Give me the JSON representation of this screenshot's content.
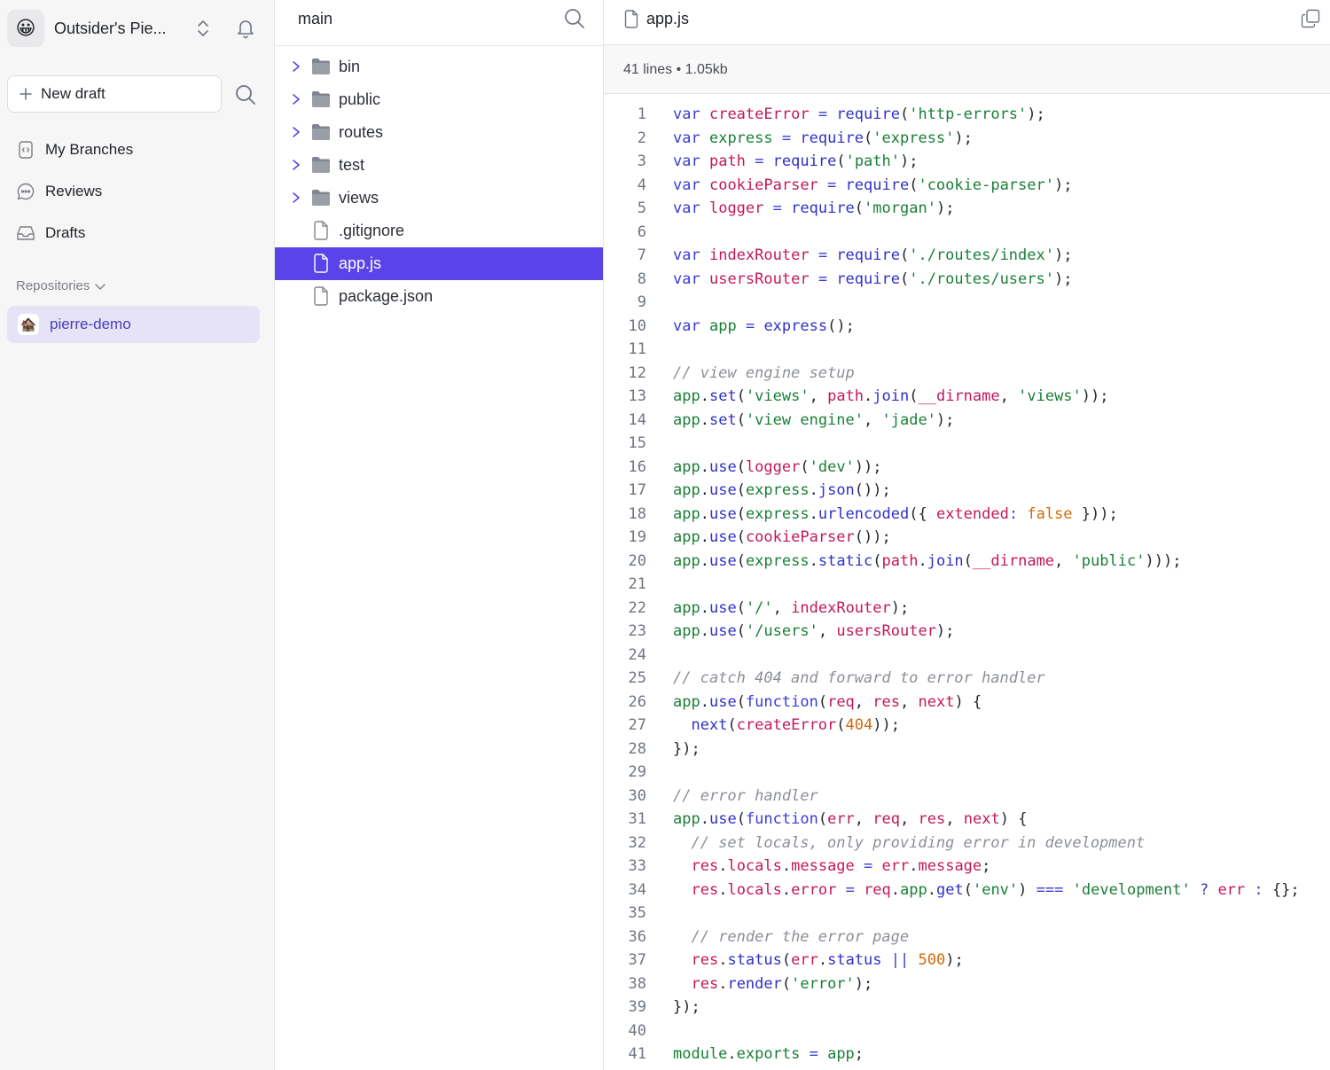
{
  "workspace": {
    "avatar_emoji": "😀",
    "name": "Outsider's Pie..."
  },
  "sidebar": {
    "new_draft_label": "New draft",
    "nav": [
      {
        "label": "My Branches",
        "icon": "branch-file-icon"
      },
      {
        "label": "Reviews",
        "icon": "chat-bubble-icon"
      },
      {
        "label": "Drafts",
        "icon": "inbox-tray-icon"
      }
    ],
    "repositories_heading": "Repositories",
    "repositories": [
      {
        "name": "pierre-demo",
        "icon_emoji": "🏚️",
        "selected": true
      }
    ]
  },
  "tree": {
    "branch": "main",
    "items": [
      {
        "label": "bin",
        "type": "folder"
      },
      {
        "label": "public",
        "type": "folder"
      },
      {
        "label": "routes",
        "type": "folder"
      },
      {
        "label": "test",
        "type": "folder"
      },
      {
        "label": "views",
        "type": "folder"
      },
      {
        "label": ".gitignore",
        "type": "file"
      },
      {
        "label": "app.js",
        "type": "file",
        "selected": true
      },
      {
        "label": "package.json",
        "type": "file"
      }
    ]
  },
  "file": {
    "name": "app.js",
    "meta": "41 lines • 1.05kb",
    "lines": [
      "var createError = require('http-errors');",
      "var express = require('express');",
      "var path = require('path');",
      "var cookieParser = require('cookie-parser');",
      "var logger = require('morgan');",
      "",
      "var indexRouter = require('./routes/index');",
      "var usersRouter = require('./routes/users');",
      "",
      "var app = express();",
      "",
      "// view engine setup",
      "app.set('views', path.join(__dirname, 'views'));",
      "app.set('view engine', 'jade');",
      "",
      "app.use(logger('dev'));",
      "app.use(express.json());",
      "app.use(express.urlencoded({ extended: false }));",
      "app.use(cookieParser());",
      "app.use(express.static(path.join(__dirname, 'public')));",
      "",
      "app.use('/', indexRouter);",
      "app.use('/users', usersRouter);",
      "",
      "// catch 404 and forward to error handler",
      "app.use(function(req, res, next) {",
      "  next(createError(404));",
      "});",
      "",
      "// error handler",
      "app.use(function(err, req, res, next) {",
      "  // set locals, only providing error in development",
      "  res.locals.message = err.message;",
      "  res.locals.error = req.app.get('env') === 'development' ? err : {};",
      "",
      "  // render the error page",
      "  res.status(err.status || 500);",
      "  res.render('error');",
      "});",
      "",
      "module.exports = app;"
    ]
  },
  "colors": {
    "accent": "#5b43ea",
    "repo_selected_bg": "#e6e3f7",
    "keyword": "#3b3bd6",
    "variable": "#c2185b",
    "string": "#1a7f37",
    "comment": "#8b8f96",
    "number": "#d4680a"
  }
}
